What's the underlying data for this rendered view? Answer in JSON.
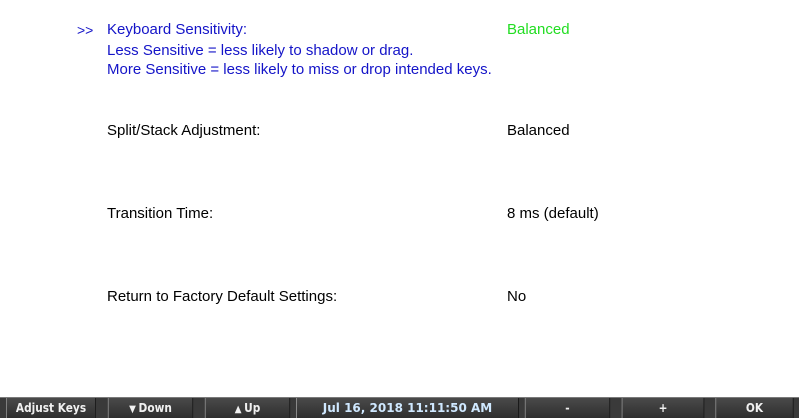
{
  "settings": {
    "selection_marker": ">>",
    "items": [
      {
        "label": "Keyboard Sensitivity:",
        "value": "Balanced",
        "help": [
          "Less Sensitive = less likely to shadow or drag.",
          "More Sensitive = less likely to miss or drop intended keys."
        ]
      },
      {
        "label": "Split/Stack Adjustment:",
        "value": "Balanced"
      },
      {
        "label": "Transition Time:",
        "value": "8 ms (default)"
      },
      {
        "label": "Return to Factory Default Settings:",
        "value": "No"
      }
    ]
  },
  "softkeys": {
    "adjust_keys": "Adjust Keys",
    "down": "Down",
    "up": "Up",
    "datetime": "Jul 16, 2018  11:11:50 AM",
    "minus": "-",
    "plus": "+",
    "ok": "OK"
  },
  "icons": {
    "down": "triangle-down-icon",
    "up": "triangle-up-icon"
  },
  "colors": {
    "selected_text": "#1414c8",
    "selected_value": "#22dd22",
    "normal_text": "#000000",
    "softkey_bar": "#3a3a3a",
    "clock_text": "#cfe8ff"
  }
}
